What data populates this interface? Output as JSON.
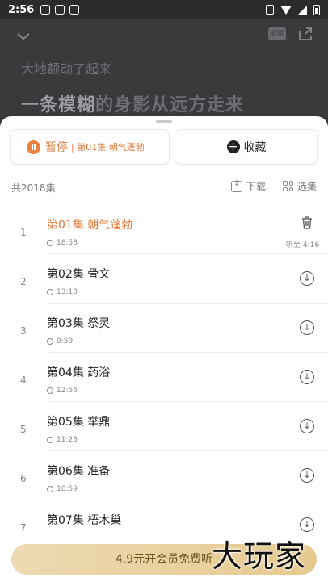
{
  "status_bar": {
    "time": "2:56"
  },
  "player": {
    "lyric_badge": "封面",
    "lyric_prev": "大地颤动了起来",
    "lyric_current_highlight": "一条模糊",
    "lyric_current_rest": "的身影从远方走来"
  },
  "actions": {
    "pause_label": "暂停",
    "pause_episode": "| 第01集 朝气蓬勃",
    "favorite_label": "收藏"
  },
  "meta": {
    "total": "共2018集",
    "download_label": "下载",
    "select_label": "选集"
  },
  "episodes": [
    {
      "num": "1",
      "title": "第01集 朝气蓬勃",
      "duration": "18:58",
      "progress": "听至 4:16"
    },
    {
      "num": "2",
      "title": "第02集 骨文",
      "duration": "13:10"
    },
    {
      "num": "3",
      "title": "第03集 祭灵",
      "duration": "9:59"
    },
    {
      "num": "4",
      "title": "第04集 药浴",
      "duration": "12:56"
    },
    {
      "num": "5",
      "title": "第05集 举鼎",
      "duration": "11:28"
    },
    {
      "num": "6",
      "title": "第06集 准备",
      "duration": "10:59"
    },
    {
      "num": "7",
      "title": "第07集 梧木巢",
      "duration": ""
    }
  ],
  "vip_bar": {
    "label": "4.9元开会员免费听"
  },
  "watermark": "大玩家",
  "colors": {
    "accent": "#e07a3a",
    "vip_gold": "#e6c98e"
  }
}
